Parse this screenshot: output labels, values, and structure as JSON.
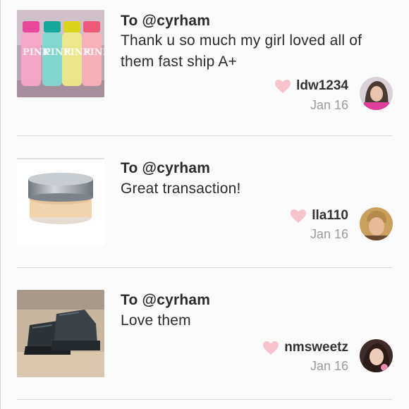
{
  "reviews": [
    {
      "to": "To @cyrham",
      "message": "Thank u so much my girl loved all of them fast ship A+",
      "username": "ldw1234",
      "date": "Jan 16",
      "thumb_label": "PINK",
      "thumb_icon": "body-mist-bottles-photo",
      "avatar_icon": "user-avatar-photo"
    },
    {
      "to": "To @cyrham",
      "message": "Great transaction!",
      "username": "lla110",
      "date": "Jan 16",
      "thumb_icon": "powder-jar-photo",
      "avatar_icon": "user-avatar-photo"
    },
    {
      "to": "To @cyrham",
      "message": "Love them",
      "username": "nmsweetz",
      "date": "Jan 16",
      "thumb_icon": "boots-photo",
      "avatar_icon": "user-avatar-photo"
    }
  ],
  "colors": {
    "heart": "#f7c3cc",
    "text": "#2b2b2b",
    "muted": "#9b9b9b",
    "divider": "#d9d9d9"
  }
}
